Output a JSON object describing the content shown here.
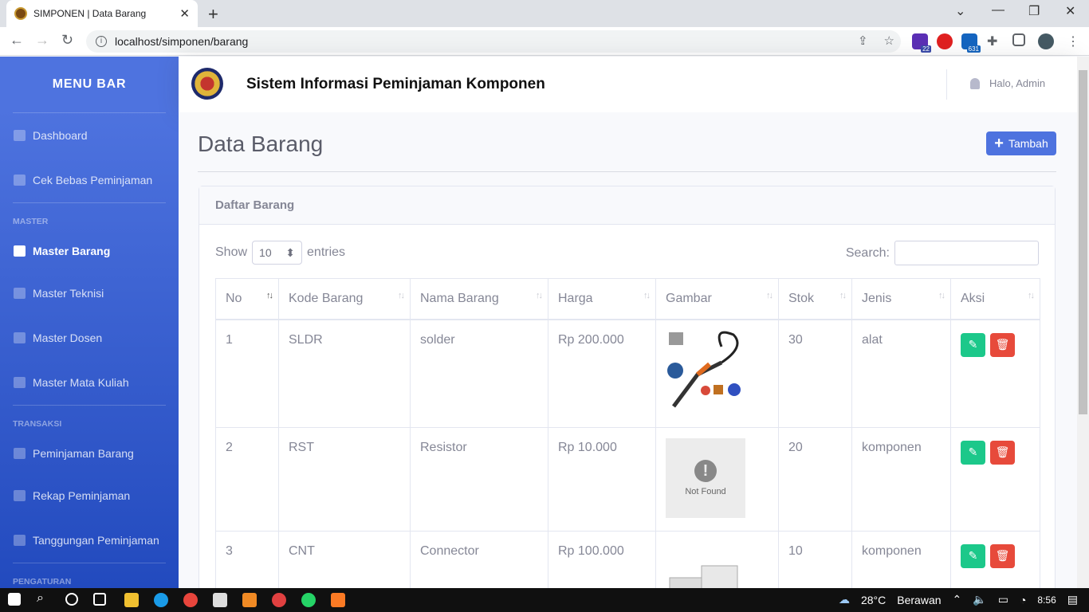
{
  "browser": {
    "tab_title": "SIMPONEN | Data Barang",
    "url": "localhost/simponen/barang",
    "ext_badge_1": "22",
    "ext_badge_2": "631"
  },
  "sidebar": {
    "brand": "MENU BAR",
    "items": [
      {
        "label": "Dashboard"
      },
      {
        "label": "Cek Bebas Peminjaman"
      }
    ],
    "heading_master": "MASTER",
    "master_items": [
      {
        "label": "Master Barang"
      },
      {
        "label": "Master Teknisi"
      },
      {
        "label": "Master Dosen"
      },
      {
        "label": "Master Mata Kuliah"
      }
    ],
    "heading_transaksi": "TRANSAKSI",
    "transaksi_items": [
      {
        "label": "Peminjaman Barang"
      },
      {
        "label": "Rekap Peminjaman"
      },
      {
        "label": "Tanggungan Peminjaman"
      }
    ],
    "heading_pengaturan": "PENGATURAN"
  },
  "topbar": {
    "title": "Sistem Informasi Peminjaman Komponen",
    "user": "Halo, Admin"
  },
  "page": {
    "heading": "Data Barang",
    "add_label": "Tambah"
  },
  "card": {
    "header": "Daftar Barang",
    "show_label": "Show",
    "entries_value": "10",
    "entries_label": "entries",
    "search_label": "Search:"
  },
  "table": {
    "headers": [
      "No",
      "Kode Barang",
      "Nama Barang",
      "Harga",
      "Gambar",
      "Stok",
      "Jenis",
      "Aksi"
    ],
    "rows": [
      {
        "no": "1",
        "kode": "SLDR",
        "nama": "solder",
        "harga": "Rp 200.000",
        "stok": "30",
        "jenis": "alat"
      },
      {
        "no": "2",
        "kode": "RST",
        "nama": "Resistor",
        "harga": "Rp 10.000",
        "stok": "20",
        "jenis": "komponen",
        "image_text": "Not Found"
      },
      {
        "no": "3",
        "kode": "CNT",
        "nama": "Connector",
        "harga": "Rp 100.000",
        "stok": "10",
        "jenis": "komponen"
      }
    ]
  },
  "taskbar": {
    "weather": "28°C",
    "weather_desc": "Berawan",
    "time": "8:56"
  }
}
